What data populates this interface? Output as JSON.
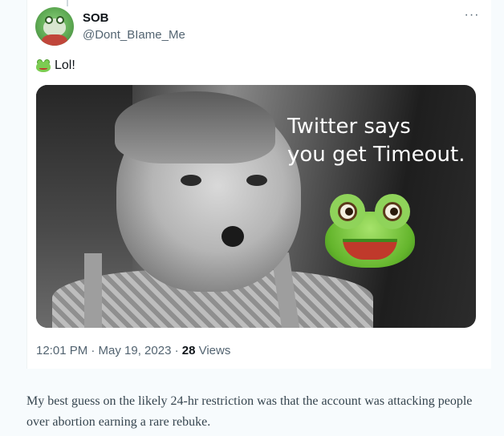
{
  "tweet": {
    "display_name": "SOB",
    "handle": "@Dont_BIame_Me",
    "more_icon": "ellipsis-icon",
    "text": "Lol!",
    "emoji": "frog-face-emoji",
    "media": {
      "caption_line1": "Twitter says",
      "caption_line2": "you get Timeout.",
      "emoji": "frog-face-emoji"
    },
    "timestamp": "12:01 PM · May 19, 2023 · ",
    "views_count": "28",
    "views_label": " Views"
  },
  "article": {
    "paragraph": "My best guess on the likely 24-hr restriction was that the account was attacking people over abortion earning a rare rebuke."
  },
  "colors": {
    "text_primary": "#0f1419",
    "text_secondary": "#536471",
    "page_background": "#f7fbfd",
    "article_text": "#36454f"
  }
}
